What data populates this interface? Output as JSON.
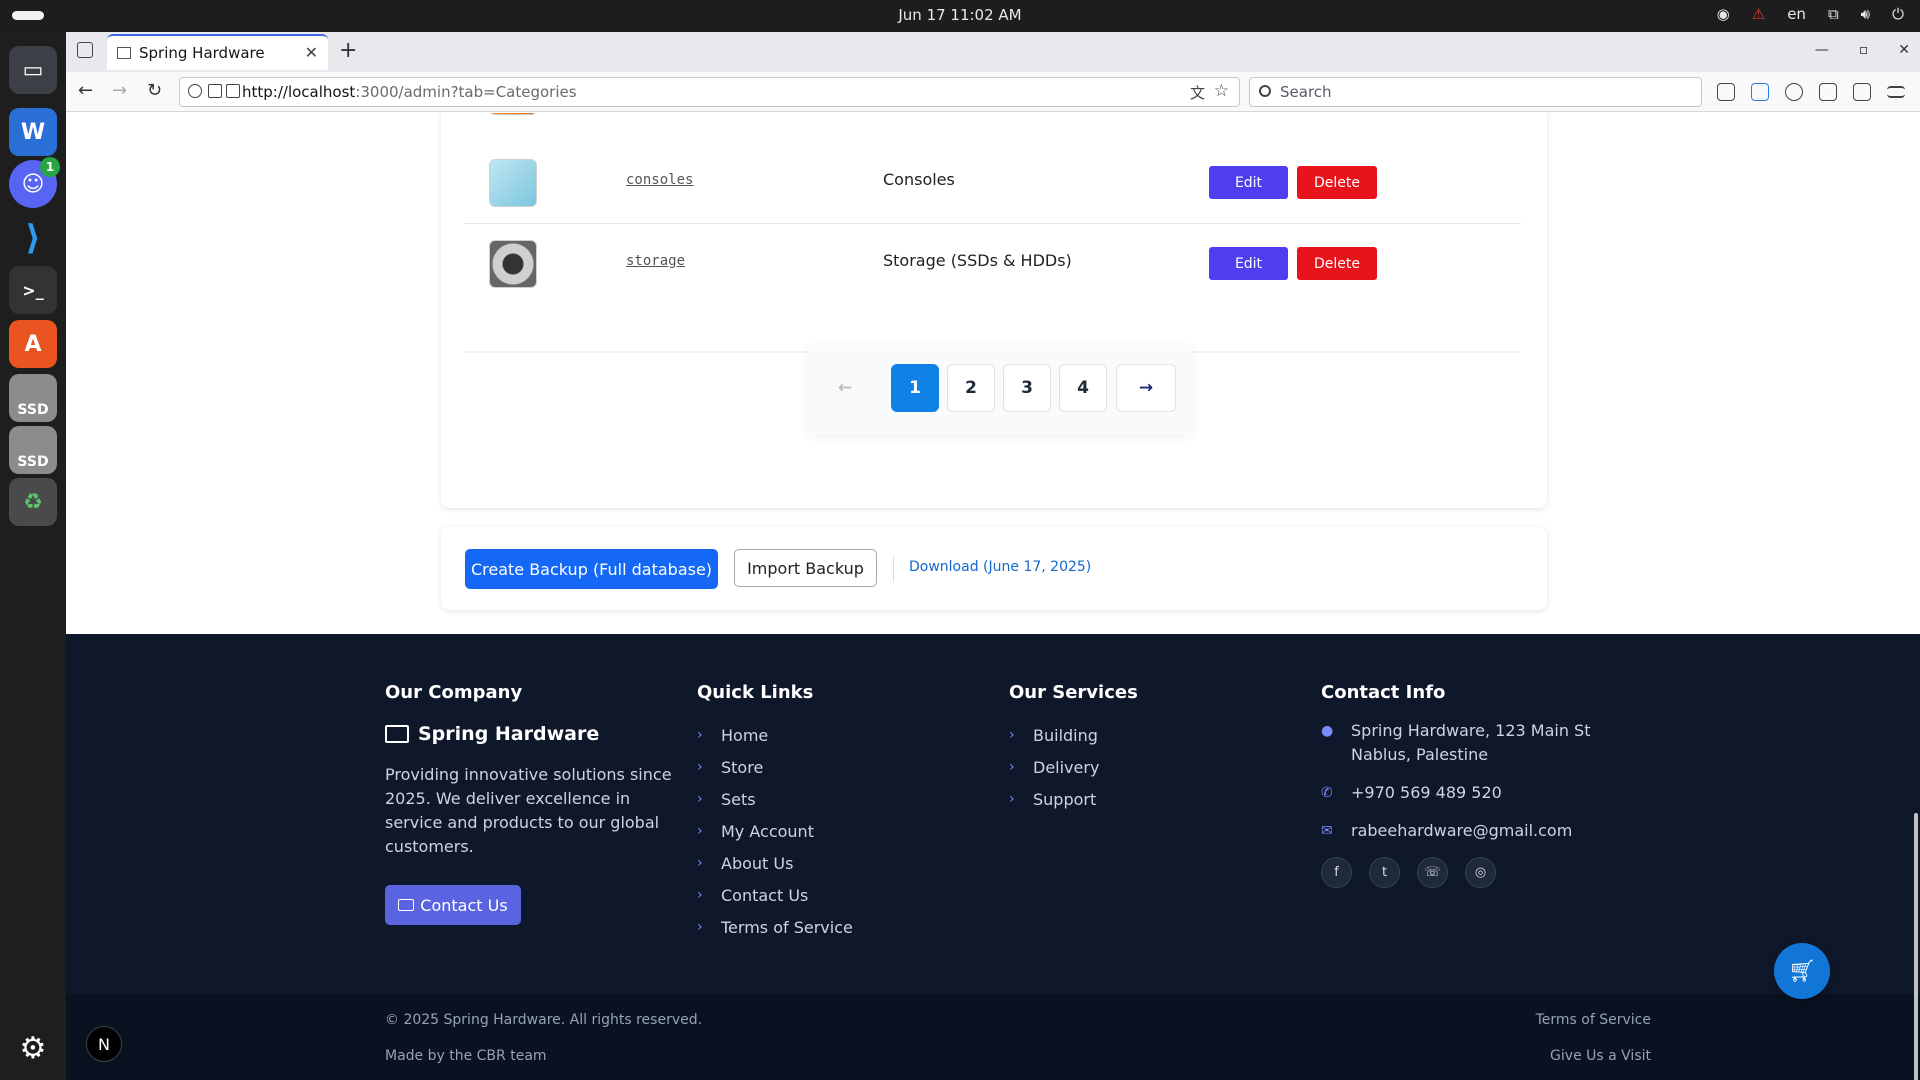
{
  "system": {
    "clock": "Jun 17  11:02 AM",
    "language": "en"
  },
  "browser": {
    "tab_title": "Spring Hardware",
    "url_host": "http://localhost",
    "url_rest": ":3000/admin?tab=Categories",
    "search_placeholder": "Search"
  },
  "dock": {
    "discord_badge": "1",
    "ssd1": "SSD",
    "ssd2": "SSD"
  },
  "categories": [
    {
      "slug": "consoles",
      "name": "Consoles",
      "edit": "Edit",
      "delete": "Delete"
    },
    {
      "slug": "storage",
      "name": "Storage (SSDs & HDDs)",
      "edit": "Edit",
      "delete": "Delete"
    }
  ],
  "pagination": {
    "prev": "←",
    "pages": [
      "1",
      "2",
      "3",
      "4"
    ],
    "next": "→"
  },
  "backup": {
    "create": "Create Backup (Full database)",
    "import": "Import Backup",
    "download": "Download (June 17, 2025)"
  },
  "footer": {
    "company": {
      "heading": "Our Company",
      "brand": "Spring Hardware",
      "description": "Providing innovative solutions since 2025. We deliver excellence in service and products to our global customers.",
      "contact_button": "Contact Us"
    },
    "quick_links": {
      "heading": "Quick Links",
      "items": [
        "Home",
        "Store",
        "Sets",
        "My Account",
        "About Us",
        "Contact Us",
        "Terms of Service"
      ]
    },
    "services": {
      "heading": "Our Services",
      "items": [
        "Building",
        "Delivery",
        "Support"
      ]
    },
    "contact": {
      "heading": "Contact Info",
      "address_line1": "Spring Hardware, 123 Main St",
      "address_line2": "Nablus, Palestine",
      "phone": "+970 569 489 520",
      "email": "rabeehardware@gmail.com"
    },
    "copyright": "© 2025 Spring Hardware. All rights reserved.",
    "made_by": "Made by the CBR team",
    "terms": "Terms of Service",
    "visit": "Give Us a Visit"
  },
  "next_badge": "N"
}
